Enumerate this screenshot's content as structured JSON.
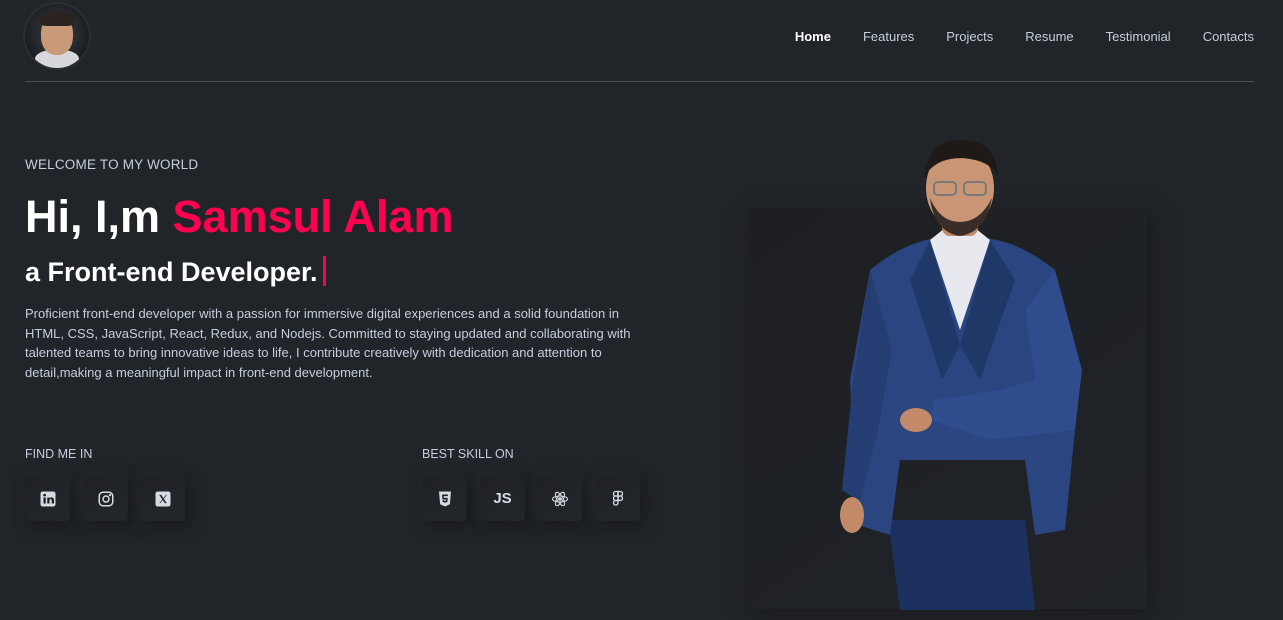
{
  "header": {
    "nav": [
      {
        "label": "Home",
        "active": true
      },
      {
        "label": "Features"
      },
      {
        "label": "Projects"
      },
      {
        "label": "Resume"
      },
      {
        "label": "Testimonial"
      },
      {
        "label": "Contacts"
      }
    ]
  },
  "hero": {
    "welcome": "WELCOME TO MY WORLD",
    "greeting": "Hi, I,m ",
    "name": "Samsul Alam",
    "subtitle": "a Front-end Developer.",
    "description": "Proficient front-end developer with a passion for immersive digital experiences and a solid foundation in HTML, CSS, JavaScript, React, Redux, and Nodejs. Committed to staying updated and collaborating with talented teams to bring innovative ideas to life, I contribute creatively with dedication and attention to detail,making a meaningful impact in front-end development."
  },
  "find_me": {
    "label": "FIND ME IN",
    "icons": [
      "linkedin-icon",
      "instagram-icon",
      "x-twitter-icon"
    ]
  },
  "skills": {
    "label": "BEST SKILL ON",
    "icons": [
      "html5-icon",
      "javascript-icon",
      "react-icon",
      "figma-icon"
    ],
    "js_text": "JS"
  },
  "colors": {
    "background": "#212428",
    "accent": "#ff014f",
    "text": "#c4cfde",
    "heading": "#ffffff"
  }
}
